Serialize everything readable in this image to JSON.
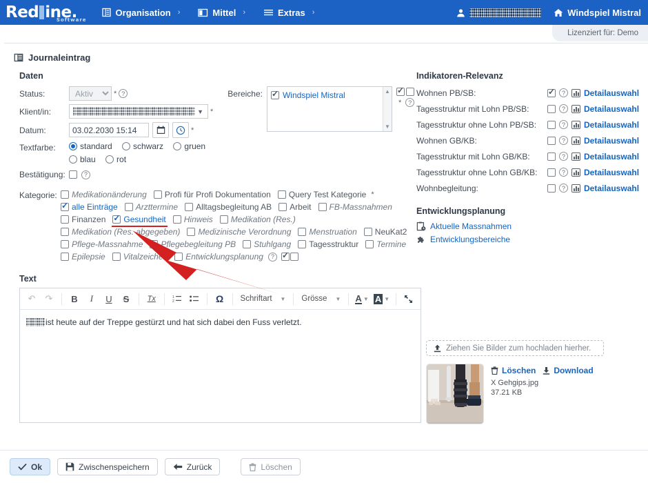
{
  "topbar": {
    "logo": {
      "part1": "Red",
      "part2": "ine",
      "dot": ".",
      "sub": "Software"
    },
    "nav": [
      {
        "label": "Organisation",
        "icon": "building-icon",
        "chev": "›"
      },
      {
        "label": "Mittel",
        "icon": "book-icon",
        "chev": "›"
      },
      {
        "label": "Extras",
        "icon": "hamburger-icon",
        "chev": "›"
      }
    ],
    "user_label": "",
    "home_label": "Windspiel Mistral",
    "license": "Lizenziert für: Demo",
    "accent": "#1b62c4"
  },
  "page": {
    "title": "Journaleintrag",
    "sections": {
      "daten": "Daten",
      "text": "Text"
    }
  },
  "daten": {
    "status": {
      "label": "Status:",
      "value": "Aktiv",
      "required": "*"
    },
    "klient": {
      "label": "Klient/in:",
      "value": "",
      "required": "*"
    },
    "datum": {
      "label": "Datum:",
      "value": "03.02.2030 15:14",
      "required": "*",
      "calendar_icon": "calendar-icon",
      "clock_icon": "clock-icon"
    },
    "textfarbe": {
      "label": "Textfarbe:",
      "options": [
        {
          "label": "standard",
          "selected": true
        },
        {
          "label": "schwarz",
          "selected": false
        },
        {
          "label": "gruen",
          "selected": false
        },
        {
          "label": "blau",
          "selected": false
        },
        {
          "label": "rot",
          "selected": false
        }
      ]
    },
    "bestaetigung": {
      "label": "Bestätigung:",
      "checked": false
    }
  },
  "bereiche": {
    "label": "Bereiche:",
    "items": [
      {
        "label": "Windspiel Mistral",
        "checked": true
      }
    ],
    "required": "*"
  },
  "kategorie": {
    "label": "Kategorie:",
    "rows": [
      [
        {
          "label": "Medikationänderung",
          "checked": false,
          "style": "italic"
        },
        {
          "label": "Profi für Profi Dokumentation",
          "checked": false,
          "style": "plain"
        },
        {
          "label": "Query Test Kategorie",
          "checked": false,
          "style": "plain",
          "suffix": "*"
        }
      ],
      [
        {
          "label": "alle Einträge",
          "checked": true,
          "style": "sel"
        },
        {
          "label": "Arzttermine",
          "checked": false,
          "style": "italic"
        },
        {
          "label": "Alltagsbegleitung AB",
          "checked": false,
          "style": "plain"
        },
        {
          "label": "Arbeit",
          "checked": false,
          "style": "plain"
        },
        {
          "label": "FB-Massnahmen",
          "checked": false,
          "style": "italic"
        }
      ],
      [
        {
          "label": "Finanzen",
          "checked": false,
          "style": "plain"
        },
        {
          "label": "Gesundheit",
          "checked": true,
          "style": "sel",
          "underline": true
        },
        {
          "label": "Hinweis",
          "checked": false,
          "style": "italic"
        },
        {
          "label": "Medikation (Res.)",
          "checked": false,
          "style": "italic"
        }
      ],
      [
        {
          "label": "Medikation (Res. abgegeben)",
          "checked": false,
          "style": "italic"
        },
        {
          "label": "Medizinische Verordnung",
          "checked": false,
          "style": "italic"
        },
        {
          "label": "Menstruation",
          "checked": false,
          "style": "italic"
        },
        {
          "label": "NeuKat2",
          "checked": false,
          "style": "plain"
        }
      ],
      [
        {
          "label": "Pflege-Massnahme",
          "checked": false,
          "style": "italic"
        },
        {
          "label": "Pflegebegleitung PB",
          "checked": false,
          "style": "italic"
        },
        {
          "label": "Stuhlgang",
          "checked": false,
          "style": "italic"
        },
        {
          "label": "Tagesstruktur",
          "checked": false,
          "style": "plain"
        },
        {
          "label": "Termine",
          "checked": false,
          "style": "italic"
        }
      ],
      [
        {
          "label": "Epilepsie",
          "checked": false,
          "style": "italic"
        },
        {
          "label": "Vitalzeichen",
          "checked": false,
          "style": "italic"
        },
        {
          "label": "Entwicklungsplanung",
          "checked": false,
          "style": "italic",
          "help": true,
          "extra_checked": true,
          "extra_unchecked": true
        }
      ]
    ]
  },
  "indikatoren": {
    "title": "Indikatoren-Relevanz",
    "detail_label": "Detailauswahl",
    "rows": [
      {
        "name": "Wohnen PB/SB:",
        "checked": true
      },
      {
        "name": "Tagesstruktur mit Lohn PB/SB:",
        "checked": false
      },
      {
        "name": "Tagesstruktur ohne Lohn PB/SB:",
        "checked": false
      },
      {
        "name": "Wohnen GB/KB:",
        "checked": false
      },
      {
        "name": "Tagesstruktur mit Lohn GB/KB:",
        "checked": false
      },
      {
        "name": "Tagesstruktur ohne Lohn GB/KB:",
        "checked": false
      },
      {
        "name": "Wohnbegleitung:",
        "checked": false
      }
    ]
  },
  "entwicklungsplanung": {
    "title": "Entwicklungsplanung",
    "links": [
      {
        "label": "Aktuelle Massnahmen",
        "icon": "clipboard-clock-icon"
      },
      {
        "label": "Entwicklungsbereiche",
        "icon": "puzzle-icon"
      }
    ]
  },
  "editor": {
    "toolbar": {
      "undo": "↶",
      "redo": "↷",
      "bold": "B",
      "italic": "I",
      "underline": "U",
      "strike": "S",
      "removeformat": "Tx",
      "numlist": "numbered-list-icon",
      "bullist": "bulleted-list-icon",
      "omega": "Ω",
      "font_label": "Schriftart",
      "size_label": "Grösse",
      "textcolor": "A",
      "bgcolor": "A",
      "maximize": "maximize-icon"
    },
    "body_text": "ist heute auf der Treppe gestürzt und hat sich dabei den Fuss verletzt."
  },
  "upload": {
    "dropzone": "Ziehen Sie Bilder zum hochladen hierher.",
    "delete_label": "Löschen",
    "download_label": "Download",
    "file_name": "X Gehgips.jpg",
    "file_size": "37.21 KB"
  },
  "footer": {
    "buttons": [
      {
        "label": "Ok",
        "icon": "check-icon",
        "primary": true
      },
      {
        "label": "Zwischenspeichern",
        "icon": "save-icon",
        "primary": false
      },
      {
        "label": "Zurück",
        "icon": "arrow-left-icon",
        "primary": false
      },
      {
        "label": "Löschen",
        "icon": "trash-icon",
        "primary": false,
        "muted": true
      }
    ]
  },
  "annotation": {
    "arrow_color": "#d32020"
  }
}
